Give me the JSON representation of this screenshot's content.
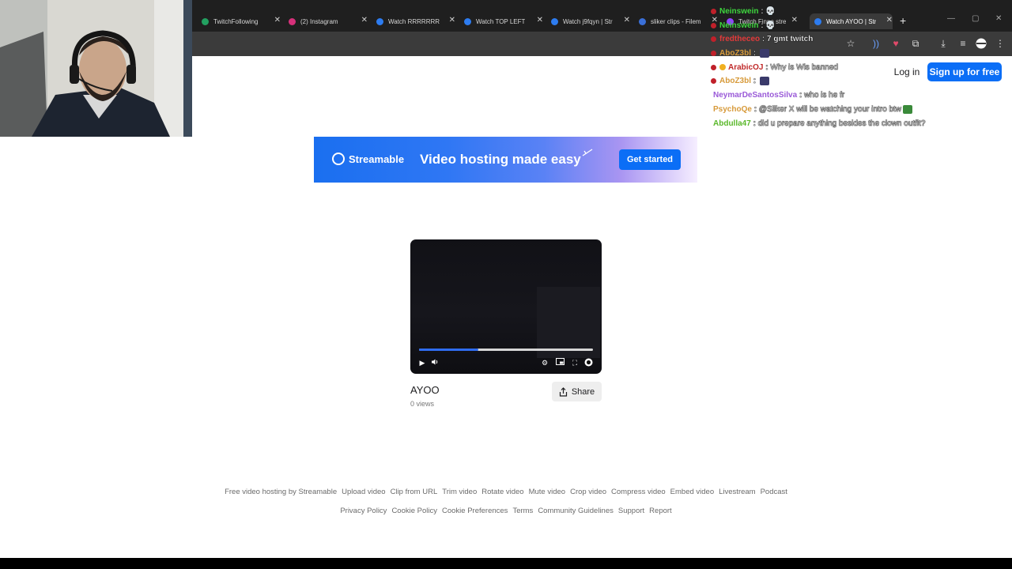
{
  "browser": {
    "tabs": [
      {
        "label": "TwitchFollowing",
        "color": "#22a060"
      },
      {
        "label": "(2) Instagram",
        "color": "#d6307a"
      },
      {
        "label": "Watch RRRRRRR",
        "color": "#2d7cf0"
      },
      {
        "label": "Watch TOP LEFT",
        "color": "#2d7cf0"
      },
      {
        "label": "Watch j9fqyn | Str",
        "color": "#2d7cf0"
      },
      {
        "label": "sliker clips - Filem",
        "color": "#3a6fd8"
      },
      {
        "label": "Twitch Finno stre",
        "color": "#9146ff"
      },
      {
        "label": "Watch AYOO | Str",
        "color": "#2d7cf0",
        "active": true
      }
    ],
    "new_tab": "+",
    "window_controls": [
      "—",
      "▢",
      "✕"
    ]
  },
  "chat": {
    "messages": [
      {
        "user": "Neinswein",
        "user_color": "#3ed63e",
        "text": "💀",
        "badge": "red"
      },
      {
        "user": "Neinswein",
        "user_color": "#3ed63e",
        "text": "💀",
        "badge": "red"
      },
      {
        "user": "fredtheceo",
        "user_color": "#e23a3a",
        "text": "7 gmt twitch",
        "badge": "red"
      },
      {
        "user": "AboZ3bl",
        "user_color": "#d79a3a",
        "text": "",
        "badge": "red",
        "emote": "#3a3a6a"
      },
      {
        "user": "ArabicOJ",
        "user_color": "#c02a2a",
        "text": "Why is Wis banned",
        "badge": "red",
        "badge2": true
      },
      {
        "user": "AboZ3bl",
        "user_color": "#d79a3a",
        "text": "",
        "badge": "red",
        "emote": "#3a3a6a"
      },
      {
        "user": "NeymarDeSantosSilva",
        "user_color": "#9a5ad8",
        "text": "who is he fr",
        "badge": ""
      },
      {
        "user": "PsychoQe",
        "user_color": "#d79a3a",
        "text": "@Sliker X will be watching your intro btw",
        "badge": "",
        "emote": "#3a8a3a"
      },
      {
        "user": "Abdulla47",
        "user_color": "#5ab82a",
        "text": "did u prepare anything besides the clown outfit?",
        "badge": ""
      }
    ]
  },
  "header": {
    "login_label": "Log in",
    "signup_label": "Sign up for free"
  },
  "banner": {
    "brand": "Streamable",
    "tagline": "Video hosting made easy",
    "cta_label": "Get started"
  },
  "video": {
    "title": "AYOO",
    "views": "0 views",
    "progress_fraction": 0.34,
    "share_label": "Share"
  },
  "footer": {
    "row1": [
      "Free video hosting by Streamable",
      "Upload video",
      "Clip from URL",
      "Trim video",
      "Rotate video",
      "Mute video",
      "Crop video",
      "Compress video",
      "Embed video",
      "Livestream",
      "Podcast"
    ],
    "row2": [
      "Privacy Policy",
      "Cookie Policy",
      "Cookie Preferences",
      "Terms",
      "Community Guidelines",
      "Support",
      "Report"
    ]
  }
}
